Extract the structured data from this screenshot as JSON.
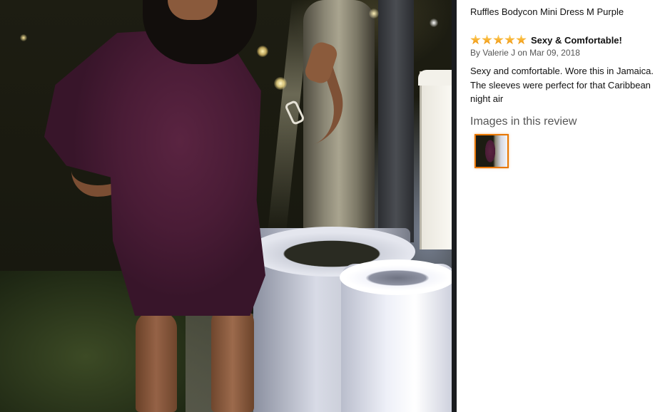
{
  "product": {
    "title": "Ruffles Bodycon Mini Dress M Purple"
  },
  "review": {
    "rating": 5,
    "rating_max": 5,
    "title": "Sexy & Comfortable!",
    "byline": "By Valerie J on Mar 09, 2018",
    "body": "Sexy and comfortable. Wore this in Jamaica. The sleeves were perfect for that Caribbean night air"
  },
  "images_section": {
    "heading": "Images in this review",
    "thumbnail_count": 1
  },
  "colors": {
    "star": "#f5a623",
    "thumb_border": "#e77600",
    "text_primary": "#111111",
    "text_secondary": "#555555"
  },
  "icons": {
    "star": "star-icon"
  }
}
